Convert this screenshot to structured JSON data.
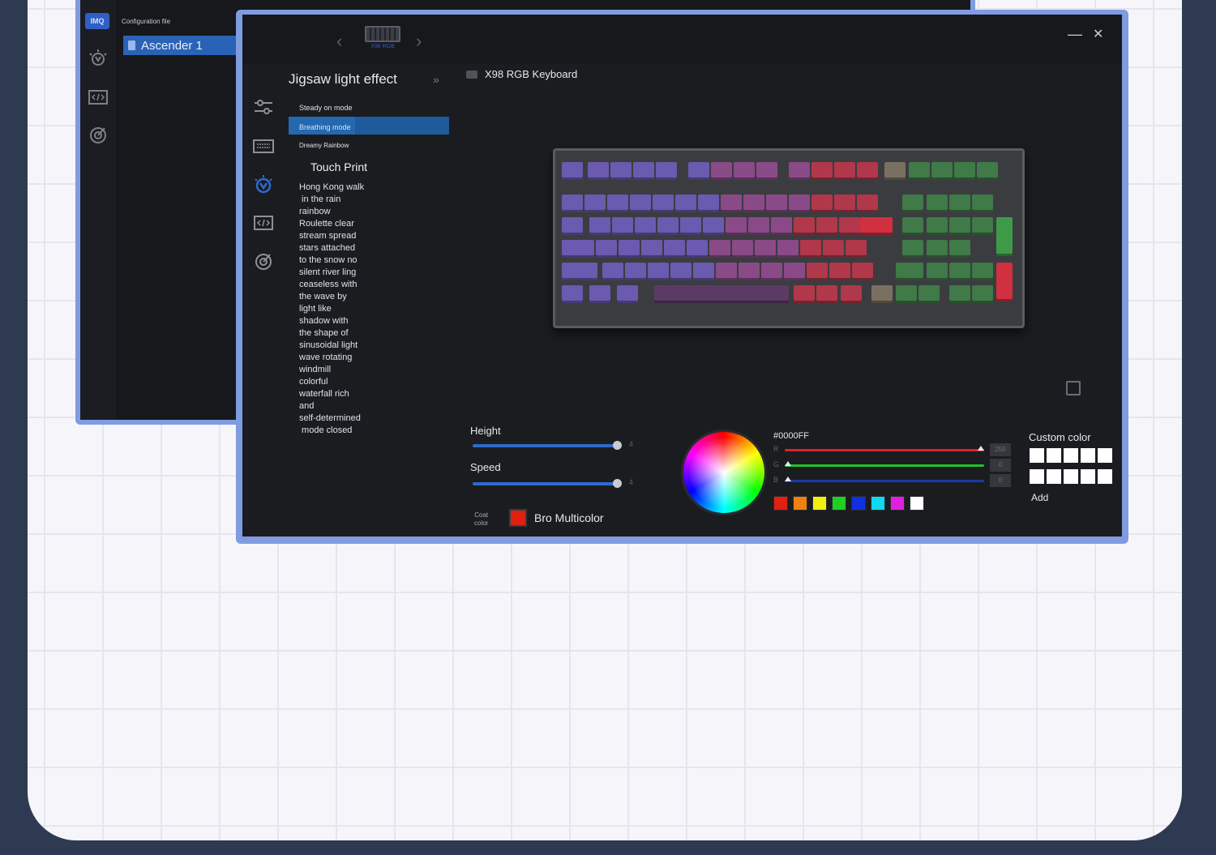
{
  "back_window": {
    "logo": "IMQ",
    "config_label": "Configuration file",
    "profile_name": "Ascender 1",
    "icons": [
      "upload-icon",
      "download-icon",
      "folder-icon"
    ]
  },
  "front_window": {
    "device_thumb_label": "X98 RGB",
    "nav_prev": "‹",
    "nav_next": "›",
    "minimize": "—",
    "close": "✕",
    "effects": {
      "title": "Jigsaw light effect",
      "collapse": "»",
      "items": [
        "Steady on mode",
        "Breathing mode",
        "Dreamy Rainbow"
      ],
      "selected": "Breathing mode",
      "touch_print": "Touch Print",
      "list": [
        "Hong Kong walk",
        " in the rain",
        "rainbow",
        "Roulette clear",
        "stream spread",
        "stars attached",
        "to the snow no",
        "silent river ling",
        "ceaseless with",
        "the wave by",
        "light like",
        "shadow with",
        "the shape of",
        "sinusoidal light",
        "wave rotating",
        "windmill",
        "colorful",
        "waterfall rich",
        "and",
        "self-determined",
        " mode closed"
      ]
    },
    "device_name": "X98 RGB Keyboard",
    "controls": {
      "height_label": "Height",
      "height_value": "4",
      "speed_label": "Speed",
      "speed_value": "4",
      "coat_label_1": "Coat",
      "coat_label_2": "color",
      "multicolor_label": "Bro Multicolor"
    },
    "color": {
      "hex": "#0000FF",
      "hex_display": "#0000FF",
      "r": {
        "label": "R",
        "value": "255"
      },
      "g": {
        "label": "G",
        "value": "0"
      },
      "b": {
        "label": "B",
        "value": "0"
      },
      "presets": [
        "#e02010",
        "#f08010",
        "#f0f010",
        "#20d020",
        "#1030e0",
        "#10d8f0",
        "#e020e0",
        "#ffffff"
      ]
    },
    "custom_color": {
      "label": "Custom color",
      "add_label": "Add"
    }
  }
}
